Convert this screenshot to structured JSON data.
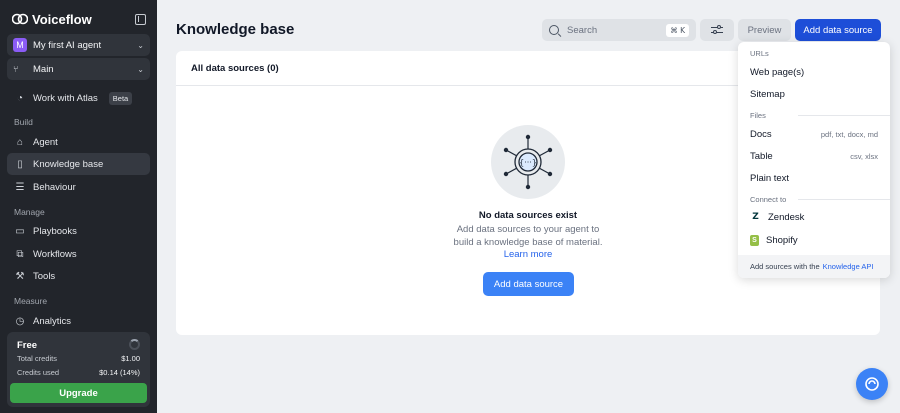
{
  "sidebar": {
    "brand": "Voiceflow",
    "agent": {
      "avatar": "M",
      "name": "My first AI agent"
    },
    "branch": "Main",
    "atlas": {
      "label": "Work with Atlas",
      "badge": "Beta"
    },
    "sections": {
      "build": "Build",
      "manage": "Manage",
      "measure": "Measure"
    },
    "items": {
      "agent": "Agent",
      "knowledge_base": "Knowledge base",
      "behaviour": "Behaviour",
      "playbooks": "Playbooks",
      "workflows": "Workflows",
      "tools": "Tools",
      "analytics": "Analytics"
    },
    "plan": {
      "title": "Free",
      "total_credits_label": "Total credits",
      "total_credits_value": "$1.00",
      "credits_used_label": "Credits used",
      "credits_used_value": "$0.14 (14%)",
      "upgrade": "Upgrade"
    }
  },
  "header": {
    "title": "Knowledge base",
    "search_placeholder": "Search",
    "search_shortcut": "⌘ K",
    "preview": "Preview",
    "add_data_source": "Add data source"
  },
  "card": {
    "header": "All data sources (0)",
    "empty_title": "No data sources exist",
    "empty_desc": "Add data sources to your agent to build a knowledge base of material.",
    "learn_more": "Learn more",
    "add_button": "Add data source"
  },
  "dropdown": {
    "urls_label": "URLs",
    "web_pages": "Web page(s)",
    "sitemap": "Sitemap",
    "files_label": "Files",
    "docs": "Docs",
    "docs_hint": "pdf, txt, docx, md",
    "table": "Table",
    "table_hint": "csv, xlsx",
    "plain_text": "Plain text",
    "connect_label": "Connect to",
    "zendesk": "Zendesk",
    "shopify": "Shopify",
    "footer_text": "Add sources with the",
    "footer_link": "Knowledge API"
  },
  "colors": {
    "sidebar_bg": "#22252b",
    "primary": "#1d4ed8",
    "accent_blue": "#3b82f6",
    "upgrade_green": "#3aa34a"
  }
}
